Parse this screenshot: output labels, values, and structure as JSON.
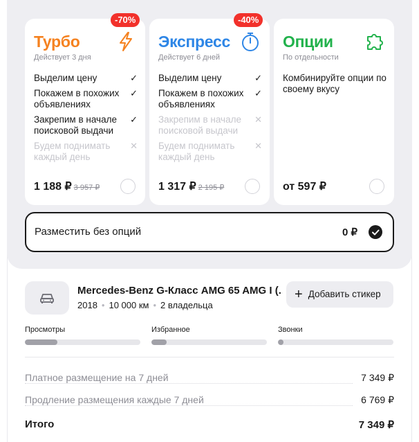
{
  "packages": [
    {
      "title": "Турбо",
      "duration": "Действует 3 дня",
      "discount": "-70%",
      "features": [
        {
          "text": "Выделим цену",
          "included": true
        },
        {
          "text": "Покажем в похожих объявлениях",
          "included": true
        },
        {
          "text": "Закрепим в начале поисковой выдачи",
          "included": true
        },
        {
          "text": "Будем поднимать каждый день",
          "included": false
        }
      ],
      "price": "1 188 ₽",
      "old_price": "3 957 ₽",
      "icon": "lightning-icon",
      "color": "#f58220"
    },
    {
      "title": "Экспресс",
      "duration": "Действует 6 дней",
      "discount": "-40%",
      "features": [
        {
          "text": "Выделим цену",
          "included": true
        },
        {
          "text": "Покажем в похожих объявлениях",
          "included": true
        },
        {
          "text": "Закрепим в начале поисковой выдачи",
          "included": false
        },
        {
          "text": "Будем поднимать каждый день",
          "included": false
        }
      ],
      "price": "1 317 ₽",
      "old_price": "2 195 ₽",
      "icon": "stopwatch-icon",
      "color": "#2e86e6"
    },
    {
      "title": "Опции",
      "duration": "По отдельности",
      "description": "Комбинируйте опции по своему вкусу",
      "price": "от 597 ₽",
      "icon": "puzzle-icon",
      "color": "#22b24c"
    }
  ],
  "no_options": {
    "label": "Разместить без опций",
    "price": "0 ₽",
    "selected": true
  },
  "listing": {
    "icon": "car-icon",
    "title": "Mercedes-Benz G-Класс AMG 65 AMG I (...",
    "year": "2018",
    "mileage": "10 000 км",
    "owners": "2 владельца",
    "sticker_button": "Добавить стикер"
  },
  "stats": [
    {
      "label": "Просмотры",
      "level": 0.28
    },
    {
      "label": "Избранное",
      "level": 0.13
    },
    {
      "label": "Звонки",
      "level": 0.05
    }
  ],
  "summary": {
    "lines": [
      {
        "label": "Платное размещение на 7 дней",
        "value": "7 349 ₽"
      },
      {
        "label": "Продление размещения каждые 7 дней",
        "value": "6 769 ₽"
      }
    ],
    "total_label": "Итого",
    "total_value": "7 349 ₽"
  },
  "colors": {
    "panel_bg": "#eeeef2",
    "discount_badge": "#f2312b",
    "selected_border": "#1a1a1a"
  }
}
